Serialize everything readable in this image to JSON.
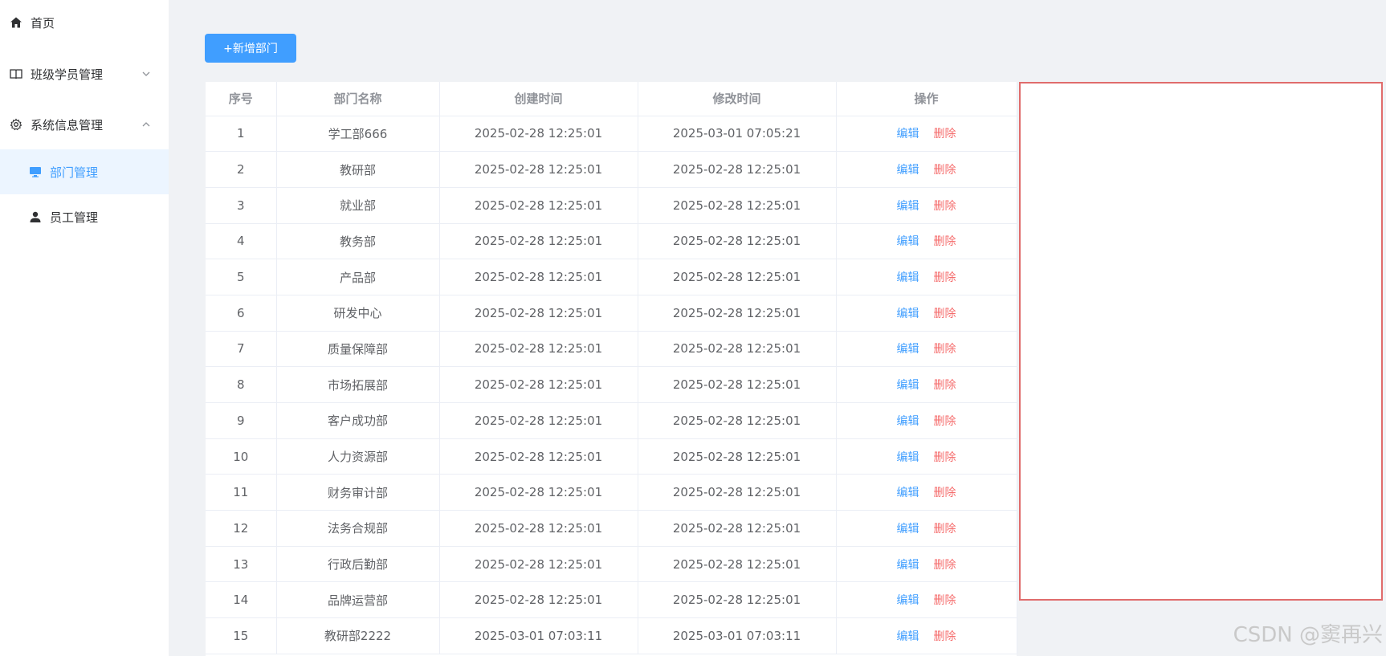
{
  "sidebar": {
    "items": [
      {
        "label": "首页",
        "icon": "home-icon"
      },
      {
        "label": "班级学员管理",
        "icon": "book-icon"
      },
      {
        "label": "系统信息管理",
        "icon": "gear-icon"
      }
    ],
    "submenu": [
      {
        "label": "部门管理",
        "icon": "monitor-icon",
        "active": true
      },
      {
        "label": "员工管理",
        "icon": "user-icon",
        "active": false
      }
    ]
  },
  "toolbar": {
    "add_label": "+新增部门"
  },
  "table": {
    "headers": [
      "序号",
      "部门名称",
      "创建时间",
      "修改时间",
      "操作"
    ],
    "edit_label": "编辑",
    "delete_label": "删除",
    "rows": [
      {
        "no": "1",
        "name": "学工部666",
        "created": "2025-02-28 12:25:01",
        "modified": "2025-03-01 07:05:21"
      },
      {
        "no": "2",
        "name": "教研部",
        "created": "2025-02-28 12:25:01",
        "modified": "2025-02-28 12:25:01"
      },
      {
        "no": "3",
        "name": "就业部",
        "created": "2025-02-28 12:25:01",
        "modified": "2025-02-28 12:25:01"
      },
      {
        "no": "4",
        "name": "教务部",
        "created": "2025-02-28 12:25:01",
        "modified": "2025-02-28 12:25:01"
      },
      {
        "no": "5",
        "name": "产品部",
        "created": "2025-02-28 12:25:01",
        "modified": "2025-02-28 12:25:01"
      },
      {
        "no": "6",
        "name": "研发中心",
        "created": "2025-02-28 12:25:01",
        "modified": "2025-02-28 12:25:01"
      },
      {
        "no": "7",
        "name": "质量保障部",
        "created": "2025-02-28 12:25:01",
        "modified": "2025-02-28 12:25:01"
      },
      {
        "no": "8",
        "name": "市场拓展部",
        "created": "2025-02-28 12:25:01",
        "modified": "2025-02-28 12:25:01"
      },
      {
        "no": "9",
        "name": "客户成功部",
        "created": "2025-02-28 12:25:01",
        "modified": "2025-02-28 12:25:01"
      },
      {
        "no": "10",
        "name": "人力资源部",
        "created": "2025-02-28 12:25:01",
        "modified": "2025-02-28 12:25:01"
      },
      {
        "no": "11",
        "name": "财务审计部",
        "created": "2025-02-28 12:25:01",
        "modified": "2025-02-28 12:25:01"
      },
      {
        "no": "12",
        "name": "法务合规部",
        "created": "2025-02-28 12:25:01",
        "modified": "2025-02-28 12:25:01"
      },
      {
        "no": "13",
        "name": "行政后勤部",
        "created": "2025-02-28 12:25:01",
        "modified": "2025-02-28 12:25:01"
      },
      {
        "no": "14",
        "name": "品牌运营部",
        "created": "2025-02-28 12:25:01",
        "modified": "2025-02-28 12:25:01"
      },
      {
        "no": "15",
        "name": "教研部2222",
        "created": "2025-03-01 07:03:11",
        "modified": "2025-03-01 07:03:11"
      }
    ]
  },
  "watermark": "CSDN @窦再兴",
  "colors": {
    "primary": "#409eff",
    "danger": "#f56c6c",
    "highlight_border": "#e06c6c",
    "active_bg": "#ecf5ff"
  }
}
